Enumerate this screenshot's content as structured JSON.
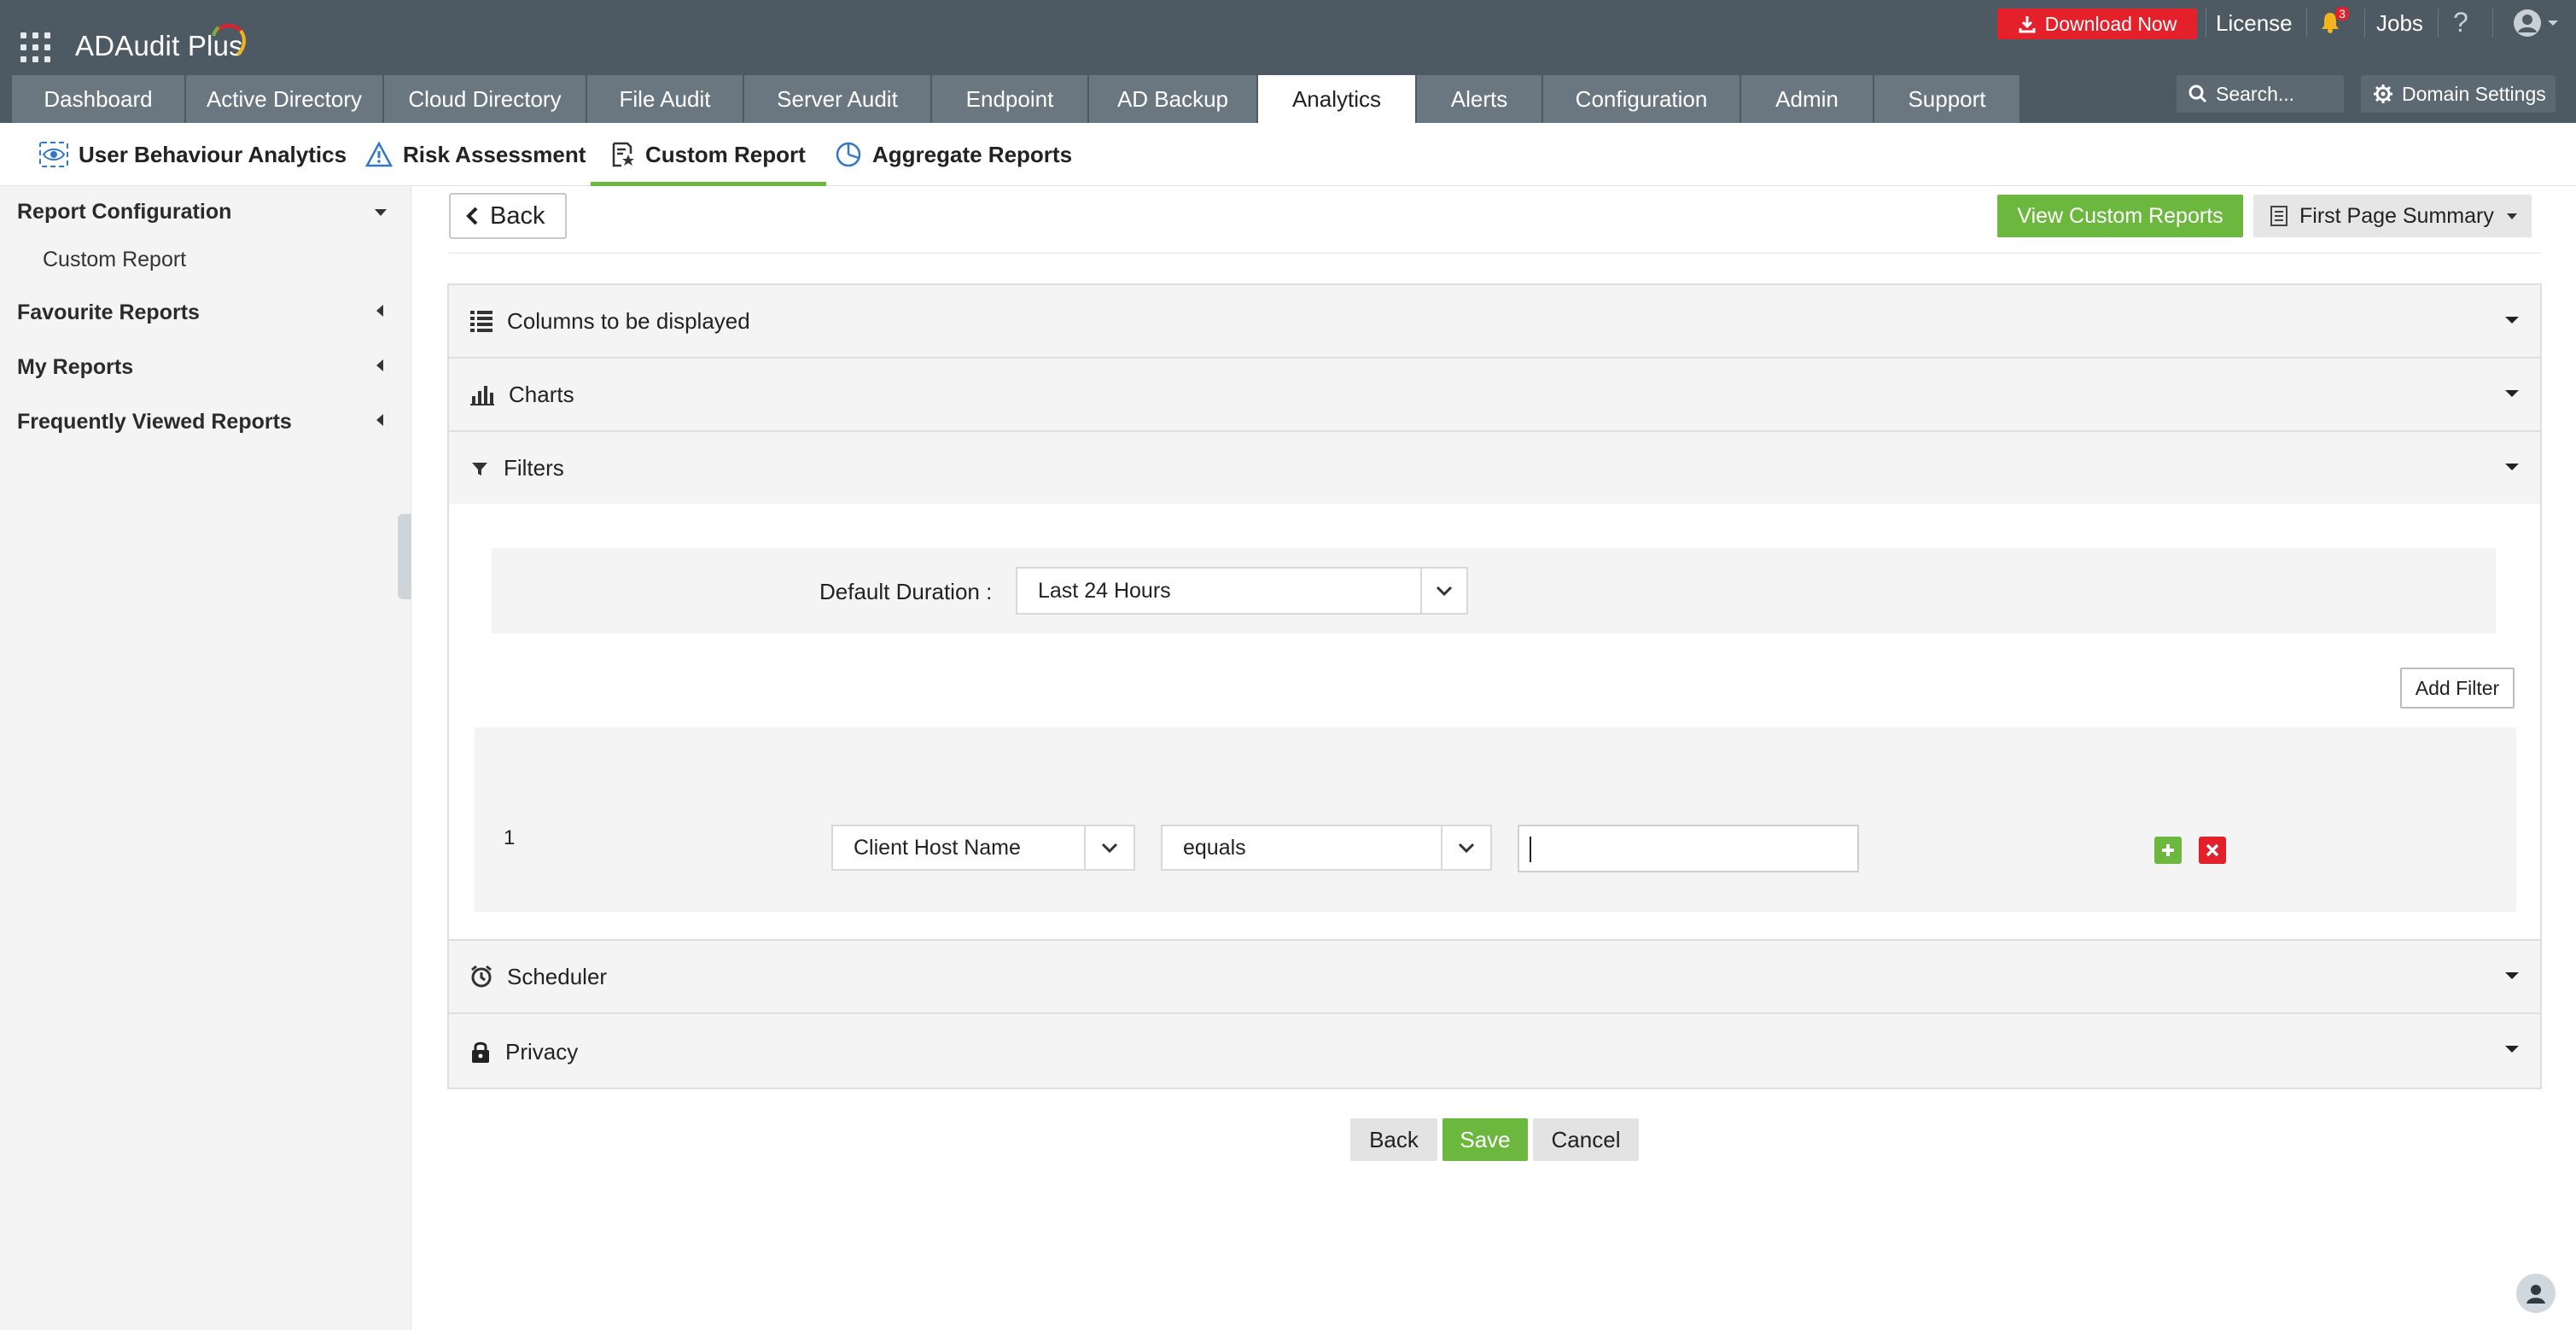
{
  "app": {
    "name": "ADAudit Plus",
    "colors": {
      "topbar": "#4d5963",
      "tab_inactive": "#6b7780",
      "accent_green": "#6cb73e",
      "download_red": "#e4212b"
    }
  },
  "topbar": {
    "apps_icon": "grid-icon",
    "download_label": "Download Now",
    "license_label": "License",
    "notification_count": "3",
    "jobs_label": "Jobs",
    "help_label": "?",
    "search_placeholder": "Search...",
    "domain_settings_label": "Domain Settings"
  },
  "main_tabs": [
    {
      "label": "Dashboard"
    },
    {
      "label": "Active Directory"
    },
    {
      "label": "Cloud Directory"
    },
    {
      "label": "File Audit"
    },
    {
      "label": "Server Audit"
    },
    {
      "label": "Endpoint"
    },
    {
      "label": "AD Backup"
    },
    {
      "label": "Analytics",
      "active": true
    },
    {
      "label": "Alerts"
    },
    {
      "label": "Configuration"
    },
    {
      "label": "Admin"
    },
    {
      "label": "Support"
    }
  ],
  "subnav": [
    {
      "label": "User Behaviour Analytics",
      "icon": "eye-icon"
    },
    {
      "label": "Risk Assessment",
      "icon": "warning-triangle-icon"
    },
    {
      "label": "Custom Report",
      "icon": "report-star-icon",
      "active": true
    },
    {
      "label": "Aggregate Reports",
      "icon": "pie-chart-icon"
    }
  ],
  "sidebar": {
    "sections": [
      {
        "label": "Report Configuration",
        "expanded": true,
        "items": [
          "Custom Report"
        ]
      },
      {
        "label": "Favourite Reports",
        "expanded": false
      },
      {
        "label": "My Reports",
        "expanded": false
      },
      {
        "label": "Frequently Viewed Reports",
        "expanded": false
      }
    ]
  },
  "content": {
    "back_label": "Back",
    "view_custom_reports_label": "View Custom Reports",
    "first_page_summary_label": "First Page Summary",
    "panels": {
      "columns": "Columns to be displayed",
      "charts": "Charts",
      "filters": "Filters",
      "scheduler": "Scheduler",
      "privacy": "Privacy"
    },
    "filters": {
      "default_duration_label": "Default Duration :",
      "default_duration_value": "Last 24 Hours",
      "add_filter_label": "Add Filter",
      "rows": [
        {
          "index": "1",
          "field": "Client Host Name",
          "operator": "equals",
          "value": ""
        }
      ]
    },
    "actions": {
      "back": "Back",
      "save": "Save",
      "cancel": "Cancel"
    }
  }
}
